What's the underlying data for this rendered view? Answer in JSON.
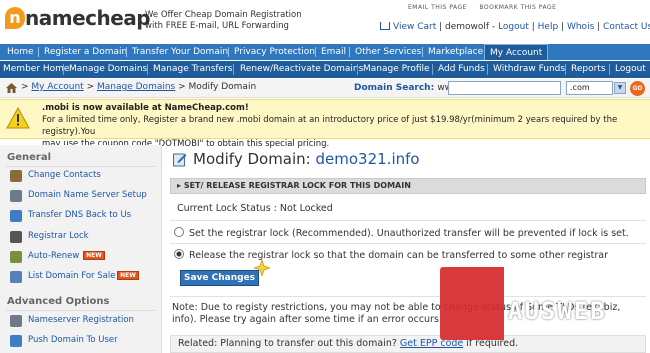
{
  "header": {
    "logo_text": "namecheap",
    "tagline_line1": "We Offer Cheap Domain Registration",
    "tagline_line2": "with FREE E-mail, URL Forwarding",
    "email_link": "EMAIL THIS PAGE",
    "bookmark_link": "BOOKMARK THIS PAGE",
    "view_cart": "View Cart",
    "username": "demowolf",
    "logout": "Logout",
    "help": "Help",
    "whois": "Whois",
    "contact": "Contact Us"
  },
  "nav_main": [
    "Home",
    "Register a Domain",
    "Transfer Your Domain",
    "Privacy Protection",
    "Email",
    "Other Services",
    "Marketplace",
    "My Account"
  ],
  "nav_sub": [
    "Member Home",
    "Manage Domains",
    "Manage Transfers",
    "Renew/Reactivate Domains",
    "Manage Profile",
    "Add Funds",
    "Withdraw Funds",
    "Reports",
    "Logout"
  ],
  "breadcrumb": {
    "sep": ">",
    "items": [
      "My Account",
      "Manage Domains",
      "Modify Domain"
    ]
  },
  "domain_search": {
    "label": "Domain Search:",
    "prefix": "www.",
    "value": "",
    "tld": ".com",
    "go": "GO"
  },
  "alert": {
    "title": ".mobi is now available at NameCheap.com!",
    "line2": "For a limited time only, Register a brand new .mobi domain at an introductory price of just $19.98/yr(minimum 2 years required by the registry).You",
    "line3": "may use the coupon code \"DOTMOBI\" to obtain this special pricing."
  },
  "sidebar": {
    "general_title": "General",
    "general_items": [
      {
        "label": "Change Contacts",
        "icon": "contacts-icon",
        "badge": ""
      },
      {
        "label": "Domain Name Server Setup",
        "icon": "dns-icon",
        "badge": ""
      },
      {
        "label": "Transfer DNS Back to Us",
        "icon": "transfer-icon",
        "badge": ""
      },
      {
        "label": "Registrar Lock",
        "icon": "lock-icon",
        "badge": ""
      },
      {
        "label": "Auto-Renew",
        "icon": "renew-icon",
        "badge": "NEW"
      },
      {
        "label": "List Domain For Sale",
        "icon": "sale-icon",
        "badge": "NEW"
      }
    ],
    "advanced_title": "Advanced Options",
    "advanced_items": [
      {
        "label": "Nameserver Registration",
        "icon": "nameserver-icon"
      },
      {
        "label": "Push Domain To User",
        "icon": "push-icon"
      }
    ]
  },
  "main": {
    "title": "Modify Domain:",
    "domain": "demo321.info",
    "section_title": "SET/ RELEASE REGISTRAR LOCK FOR THIS DOMAIN",
    "lock_status_label": "Current Lock Status :",
    "lock_status_value": "Not Locked",
    "option1": "Set the registrar lock (Recommended). Unauthorized transfer will be prevented if lock is set.",
    "option2": "Release the registrar lock so that the domain can be transferred to some other registrar",
    "save_button": "Save Changes",
    "note_line1": "Note: Due to registy restrictions, you may not be able to change status of Some TLDs (ex: biz,",
    "note_line2": "info). Please try again after some time if an error occurs.",
    "related_text": "Related: Planning to transfer out this domain?",
    "related_link": "Get EPP code",
    "related_suffix": "if required."
  },
  "watermark": {
    "text": "AUSWEB"
  },
  "colors": {
    "nav_blue": "#2f78bf",
    "nav_dark": "#1f5c9c",
    "link": "#1f56a8",
    "alert_bg": "#fff8c4",
    "badge_orange": "#e0561b",
    "watermark_red": "#d6292b"
  }
}
